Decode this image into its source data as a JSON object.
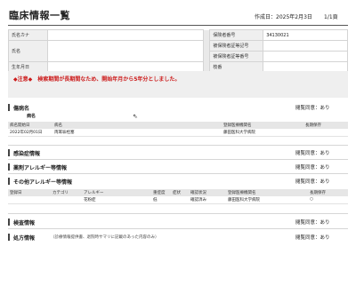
{
  "header": {
    "title": "臨床情報一覧",
    "created": "作成日：2025年2月3日",
    "page": "1/1頁"
  },
  "patient": {
    "kana_label": "氏名カナ",
    "kana_value": "",
    "name_label": "氏名",
    "name_value": "",
    "birth_label": "生年月日",
    "birth_value": "",
    "insurer_label": "保険者番号",
    "insurer_value": "34130021",
    "symbol_label": "被保険者証等記号",
    "symbol_value": "",
    "number_label": "被保険者証等番号",
    "number_value": "",
    "branch_label": "枝番",
    "branch_value": ""
  },
  "notice": {
    "text": "◆注意◆　検索期間が長期間なため、開始年月から5年分としました。"
  },
  "sections": {
    "disease": {
      "title": "傷病名",
      "consent": "閲覧同意：あり",
      "sublabel": "病名",
      "headers": [
        "病名開始日",
        "病名",
        "",
        "",
        "",
        "登録医療機関名",
        "長期保存"
      ],
      "rows": [
        [
          "2022年02月01日",
          "両耳垢栓塞",
          "",
          "",
          "",
          "藤田医科大学病院",
          ""
        ]
      ]
    },
    "infection": {
      "title": "感染症情報",
      "consent": "閲覧同意：あり"
    },
    "drug_allergy": {
      "title": "薬剤アレルギー等情報",
      "consent": "閲覧同意：あり"
    },
    "other_allergy": {
      "title": "その他アレルギー等情報",
      "consent": "閲覧同意：あり",
      "headers": [
        "登録日",
        "カテゴリ",
        "アレルギー",
        "重症度",
        "症状",
        "確認状況",
        "登録医療機関名",
        "長期保存"
      ],
      "rows": [
        [
          "",
          "",
          "花粉症",
          "低",
          "",
          "確認済み",
          "藤田医科大学病院",
          "○"
        ]
      ]
    },
    "exam": {
      "title": "検査情報",
      "consent": "閲覧同意：あり"
    },
    "prescription": {
      "title": "処方情報",
      "subtitle": "（診療情報提供書、退院時サマリに記載のあった内容のみ）",
      "consent": "閲覧同意：あり"
    }
  }
}
